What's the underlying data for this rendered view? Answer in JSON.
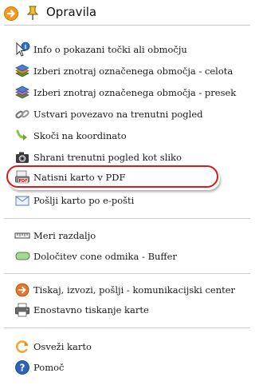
{
  "header": {
    "title": "Opravila",
    "collapse_icon": "orange-arrow-icon",
    "pin_icon": "pin-icon"
  },
  "items": [
    {
      "label": "Info o pokazani točki ali območju",
      "icon": "info-cursor-icon"
    },
    {
      "label": "Izberi znotraj označenega območja - celota",
      "icon": "layers-select-icon"
    },
    {
      "label": "Izberi znotraj označenega območja - presek",
      "icon": "layers-intersect-icon"
    },
    {
      "label": "Ustvari povezavo na trenutni pogled",
      "icon": "chain-link-icon"
    },
    {
      "label": "Skoči na koordinato",
      "icon": "jump-arrow-icon"
    },
    {
      "label": "Shrani trenutni pogled kot sliko",
      "icon": "camera-icon"
    },
    {
      "label": "Natisni karto v PDF",
      "icon": "pdf-icon",
      "highlighted": true
    },
    {
      "label": "Pošlji karto po e-pošti",
      "icon": "envelope-icon"
    },
    {
      "label": "Meri razdaljo",
      "icon": "ruler-icon"
    },
    {
      "label": "Določitev cone odmika - Buffer",
      "icon": "buffer-shape-icon"
    },
    {
      "label": "Tiskaj, izvozi, pošlji - komunikacijski center",
      "icon": "communication-center-icon"
    },
    {
      "label": "Enostavno tiskanje karte",
      "icon": "printer-icon"
    },
    {
      "label": "Osveži karto",
      "icon": "refresh-icon"
    },
    {
      "label": "Pomoč",
      "icon": "help-icon"
    }
  ],
  "colors": {
    "highlight": "#d31c1c",
    "header_arrow": "#f5a623",
    "separator": "#cfcfcf"
  }
}
